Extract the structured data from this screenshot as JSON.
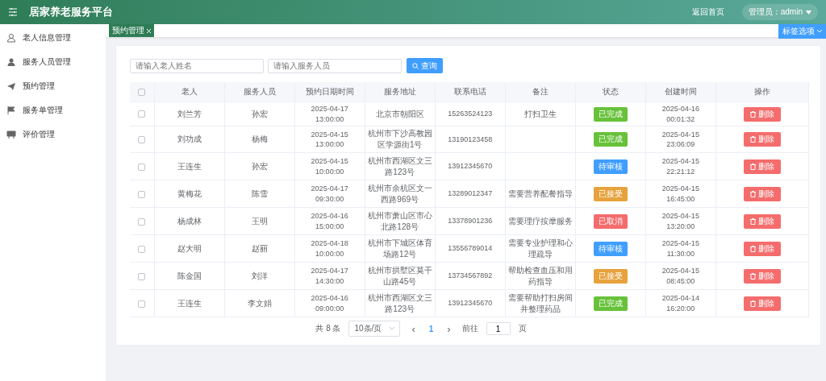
{
  "header": {
    "title": "居家养老服务平台",
    "home_link": "返回首页",
    "user_menu": "管理员：admin"
  },
  "sidebar": {
    "items": [
      {
        "label": "老人信息管理"
      },
      {
        "label": "服务人员管理"
      },
      {
        "label": "预约管理"
      },
      {
        "label": "服务单管理"
      },
      {
        "label": "评价管理"
      }
    ]
  },
  "tags": [
    {
      "label": "预约管理"
    }
  ],
  "tag_options": "标签选项",
  "search": {
    "fields": [
      {
        "placeholder": "请输入老人姓名"
      },
      {
        "placeholder": "请输入服务人员"
      }
    ],
    "button": "查询"
  },
  "table": {
    "columns": [
      "老人",
      "服务人员",
      "预约日期时间",
      "服务地址",
      "联系电话",
      "备注",
      "状态",
      "创建时间",
      "操作"
    ],
    "select_all_checked": false,
    "rows": [
      {
        "checked": false,
        "elder": "刘兰芳",
        "staff": "孙宏",
        "time": "2025-04-17 13:00:00",
        "address": "北京市朝阳区",
        "phone": "15263524123",
        "note": "打扫卫生",
        "status": "已完成",
        "color": "#67c23a",
        "created": "2025-04-16 00:01:32",
        "action": "删除"
      },
      {
        "checked": false,
        "elder": "刘功成",
        "staff": "杨梅",
        "time": "2025-04-15 13:00:00",
        "address": "杭州市下沙高教园区学源街1号",
        "phone": "13190123458",
        "status": "已完成",
        "color": "#67c23a",
        "created": "2025-04-15 23:06:09",
        "action": "删除"
      },
      {
        "checked": false,
        "elder": "王连生",
        "staff": "孙宏",
        "time": "2025-04-15 10:00:00",
        "address": "杭州市西湖区文三路123号",
        "phone": "13912345670",
        "status": "待审核",
        "color": "#409eff",
        "created": "2025-04-15 22:21:12",
        "action": "删除"
      },
      {
        "checked": false,
        "elder": "黄梅花",
        "staff": "陈雪",
        "time": "2025-04-17 09:30:00",
        "address": "杭州市余杭区文一西路969号",
        "phone": "13289012347",
        "note": "需要营养配餐指导",
        "status": "已接受",
        "color": "#e6a23c",
        "created": "2025-04-15 16:45:00",
        "action": "删除"
      },
      {
        "checked": false,
        "elder": "杨成林",
        "staff": "王明",
        "time": "2025-04-16 15:00:00",
        "address": "杭州市萧山区市心北路128号",
        "phone": "13378901236",
        "note": "需要理疗按摩服务",
        "status": "已取消",
        "color": "#f56c6c",
        "created": "2025-04-15 13:20:00",
        "action": "删除"
      },
      {
        "checked": false,
        "elder": "赵大明",
        "staff": "赵丽",
        "time": "2025-04-18 10:00:00",
        "address": "杭州市下城区体育场路12号",
        "phone": "13556789014",
        "note": "需要专业护理和心理疏导",
        "status": "待审核",
        "color": "#409eff",
        "created": "2025-04-15 11:30:00",
        "action": "删除"
      },
      {
        "checked": false,
        "elder": "陈金国",
        "staff": "刘洋",
        "time": "2025-04-17 14:30:00",
        "address": "杭州市拱墅区莫干山路45号",
        "phone": "13734567892",
        "note": "帮助检查血压和用药指导",
        "status": "已接受",
        "color": "#e6a23c",
        "created": "2025-04-15 08:45:00",
        "action": "删除"
      },
      {
        "checked": false,
        "elder": "王连生",
        "staff": "李文娟",
        "time": "2025-04-16 09:00:00",
        "address": "杭州市西湖区文三路123号",
        "phone": "13912345670",
        "note": "需要帮助打扫房间并整理药品",
        "status": "已完成",
        "color": "#67c23a",
        "created": "2025-04-14 16:20:00",
        "action": "删除"
      }
    ]
  },
  "pagination": {
    "total": "共 8 条",
    "page_size": "10条/页",
    "prev": "‹",
    "pages": [
      {
        "label": "1",
        "selected": true
      }
    ],
    "next": "›",
    "goto_label": "前往",
    "goto_value": "1",
    "goto_suffix": "页"
  }
}
